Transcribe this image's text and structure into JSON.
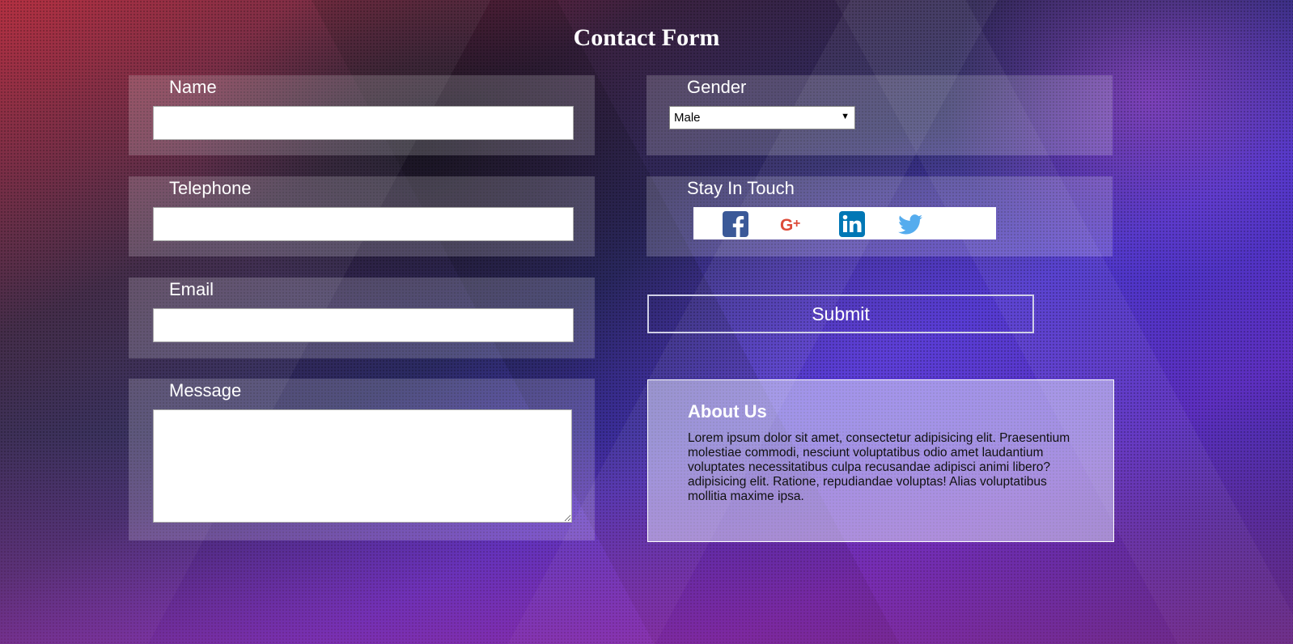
{
  "page": {
    "title": "Contact Form"
  },
  "form": {
    "name": {
      "label": "Name",
      "value": "",
      "placeholder": ""
    },
    "telephone": {
      "label": "Telephone",
      "value": "",
      "placeholder": ""
    },
    "email": {
      "label": "Email",
      "value": "",
      "placeholder": ""
    },
    "message": {
      "label": "Message",
      "value": "",
      "placeholder": ""
    },
    "gender": {
      "label": "Gender",
      "selected": "Male"
    },
    "social": {
      "label": "Stay In Touch",
      "icons": [
        "facebook-icon",
        "google-plus-icon",
        "linkedin-icon",
        "twitter-icon"
      ]
    },
    "submit_label": "Submit"
  },
  "about": {
    "title": "About Us",
    "body": "Lorem ipsum dolor sit amet, consectetur adipisicing elit. Praesentium molestiae commodi, nesciunt voluptatibus odio amet laudantium voluptates necessitatibus culpa recusandae adipisci animi libero? adipisicing elit. Ratione, repudiandae voluptas! Alias voluptatibus mollitia maxime ipsa."
  },
  "colors": {
    "facebook": "#3b5998",
    "google_plus": "#dd4b39",
    "linkedin": "#0077b5",
    "twitter": "#55acee"
  }
}
